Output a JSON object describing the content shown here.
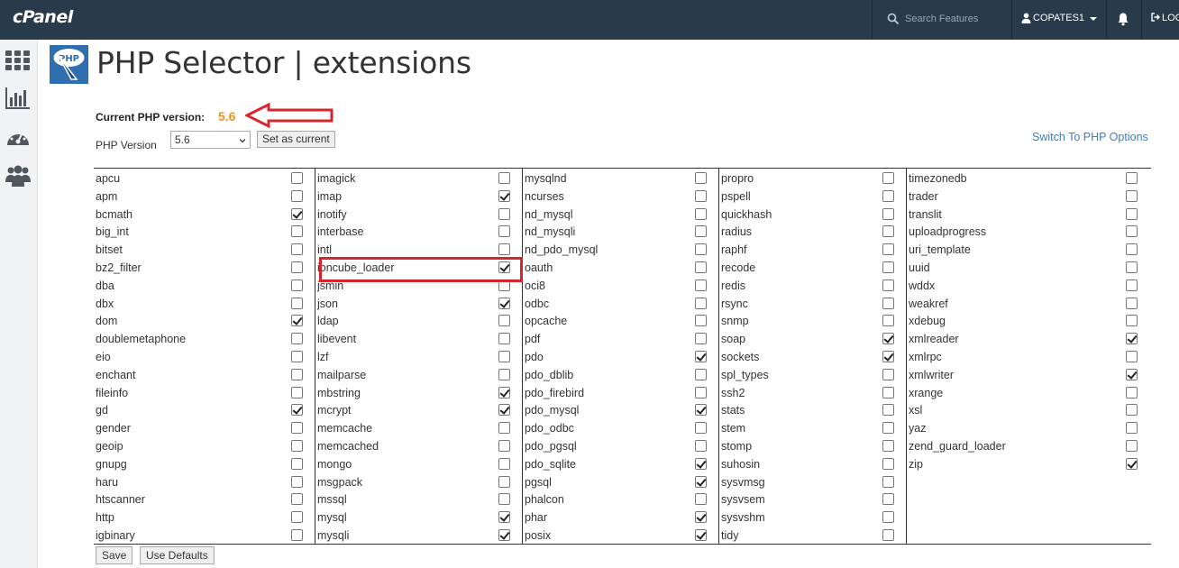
{
  "app": {
    "logo_text": "cPanel"
  },
  "topbar": {
    "search_placeholder": "Search Features",
    "user_label": "COPATES1",
    "logout_label": "LOG"
  },
  "page": {
    "title": "PHP Selector | extensions"
  },
  "current_version": {
    "label": "Current PHP version:",
    "value": "5.6"
  },
  "version_selector": {
    "label": "PHP Version",
    "selected": "5.6",
    "set_button": "Set as current"
  },
  "switch_link": "Switch To PHP Options",
  "columns": [
    {
      "items": [
        {
          "name": "apcu",
          "checked": false
        },
        {
          "name": "apm",
          "checked": false
        },
        {
          "name": "bcmath",
          "checked": true
        },
        {
          "name": "big_int",
          "checked": false
        },
        {
          "name": "bitset",
          "checked": false
        },
        {
          "name": "bz2_filter",
          "checked": false
        },
        {
          "name": "dba",
          "checked": false
        },
        {
          "name": "dbx",
          "checked": false
        },
        {
          "name": "dom",
          "checked": true
        },
        {
          "name": "doublemetaphone",
          "checked": false
        },
        {
          "name": "eio",
          "checked": false
        },
        {
          "name": "enchant",
          "checked": false
        },
        {
          "name": "fileinfo",
          "checked": false
        },
        {
          "name": "gd",
          "checked": true
        },
        {
          "name": "gender",
          "checked": false
        },
        {
          "name": "geoip",
          "checked": false
        },
        {
          "name": "gnupg",
          "checked": false
        },
        {
          "name": "haru",
          "checked": false
        },
        {
          "name": "htscanner",
          "checked": false
        },
        {
          "name": "http",
          "checked": false
        },
        {
          "name": "igbinary",
          "checked": false
        }
      ]
    },
    {
      "items": [
        {
          "name": "imagick",
          "checked": false
        },
        {
          "name": "imap",
          "checked": true
        },
        {
          "name": "inotify",
          "checked": false
        },
        {
          "name": "interbase",
          "checked": false
        },
        {
          "name": "intl",
          "checked": false
        },
        {
          "name": "ioncube_loader",
          "checked": true
        },
        {
          "name": "jsmin",
          "checked": false
        },
        {
          "name": "json",
          "checked": true
        },
        {
          "name": "ldap",
          "checked": false
        },
        {
          "name": "libevent",
          "checked": false
        },
        {
          "name": "lzf",
          "checked": false
        },
        {
          "name": "mailparse",
          "checked": false
        },
        {
          "name": "mbstring",
          "checked": true
        },
        {
          "name": "mcrypt",
          "checked": true
        },
        {
          "name": "memcache",
          "checked": false
        },
        {
          "name": "memcached",
          "checked": false
        },
        {
          "name": "mongo",
          "checked": false
        },
        {
          "name": "msgpack",
          "checked": false
        },
        {
          "name": "mssql",
          "checked": false
        },
        {
          "name": "mysql",
          "checked": true
        },
        {
          "name": "mysqli",
          "checked": true
        }
      ]
    },
    {
      "items": [
        {
          "name": "mysqlnd",
          "checked": false
        },
        {
          "name": "ncurses",
          "checked": false
        },
        {
          "name": "nd_mysql",
          "checked": false
        },
        {
          "name": "nd_mysqli",
          "checked": false
        },
        {
          "name": "nd_pdo_mysql",
          "checked": false
        },
        {
          "name": "oauth",
          "checked": false
        },
        {
          "name": "oci8",
          "checked": false
        },
        {
          "name": "odbc",
          "checked": false
        },
        {
          "name": "opcache",
          "checked": false
        },
        {
          "name": "pdf",
          "checked": false
        },
        {
          "name": "pdo",
          "checked": true
        },
        {
          "name": "pdo_dblib",
          "checked": false
        },
        {
          "name": "pdo_firebird",
          "checked": false
        },
        {
          "name": "pdo_mysql",
          "checked": true
        },
        {
          "name": "pdo_odbc",
          "checked": false
        },
        {
          "name": "pdo_pgsql",
          "checked": false
        },
        {
          "name": "pdo_sqlite",
          "checked": true
        },
        {
          "name": "pgsql",
          "checked": true
        },
        {
          "name": "phalcon",
          "checked": false
        },
        {
          "name": "phar",
          "checked": true
        },
        {
          "name": "posix",
          "checked": true
        }
      ]
    },
    {
      "items": [
        {
          "name": "propro",
          "checked": false
        },
        {
          "name": "pspell",
          "checked": false
        },
        {
          "name": "quickhash",
          "checked": false
        },
        {
          "name": "radius",
          "checked": false
        },
        {
          "name": "raphf",
          "checked": false
        },
        {
          "name": "recode",
          "checked": false
        },
        {
          "name": "redis",
          "checked": false
        },
        {
          "name": "rsync",
          "checked": false
        },
        {
          "name": "snmp",
          "checked": false
        },
        {
          "name": "soap",
          "checked": true
        },
        {
          "name": "sockets",
          "checked": true
        },
        {
          "name": "spl_types",
          "checked": false
        },
        {
          "name": "ssh2",
          "checked": false
        },
        {
          "name": "stats",
          "checked": false
        },
        {
          "name": "stem",
          "checked": false
        },
        {
          "name": "stomp",
          "checked": false
        },
        {
          "name": "suhosin",
          "checked": false
        },
        {
          "name": "sysvmsg",
          "checked": false
        },
        {
          "name": "sysvsem",
          "checked": false
        },
        {
          "name": "sysvshm",
          "checked": false
        },
        {
          "name": "tidy",
          "checked": false
        }
      ]
    },
    {
      "items": [
        {
          "name": "timezonedb",
          "checked": false
        },
        {
          "name": "trader",
          "checked": false
        },
        {
          "name": "translit",
          "checked": false
        },
        {
          "name": "uploadprogress",
          "checked": false
        },
        {
          "name": "uri_template",
          "checked": false
        },
        {
          "name": "uuid",
          "checked": false
        },
        {
          "name": "wddx",
          "checked": false
        },
        {
          "name": "weakref",
          "checked": false
        },
        {
          "name": "xdebug",
          "checked": false
        },
        {
          "name": "xmlreader",
          "checked": true
        },
        {
          "name": "xmlrpc",
          "checked": false
        },
        {
          "name": "xmlwriter",
          "checked": true
        },
        {
          "name": "xrange",
          "checked": false
        },
        {
          "name": "xsl",
          "checked": false
        },
        {
          "name": "yaz",
          "checked": false
        },
        {
          "name": "zend_guard_loader",
          "checked": false
        },
        {
          "name": "zip",
          "checked": true
        }
      ]
    }
  ],
  "buttons": {
    "save": "Save",
    "use_defaults": "Use Defaults"
  },
  "colors": {
    "topbar": "#293a4a",
    "accent_orange": "#f0931c",
    "highlight_red": "#d7262b",
    "link_blue": "#3e7ebd"
  },
  "icons": [
    "search-icon",
    "user-icon",
    "bell-icon",
    "logout-icon",
    "apps-grid-icon",
    "stats-chart-icon",
    "dashboard-gauge-icon",
    "users-group-icon",
    "php-logo-icon",
    "red-arrow-icon"
  ]
}
